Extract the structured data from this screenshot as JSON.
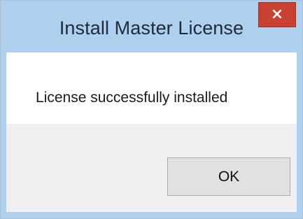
{
  "window": {
    "title": "Install Master License",
    "close_icon": "close-icon",
    "close_glyph": "×"
  },
  "dialog": {
    "message": "License successfully installed",
    "ok_label": "OK"
  },
  "colors": {
    "titlebar": "#afcfee",
    "close_button": "#c84131",
    "footer": "#f0f0f0",
    "button_face": "#e1e1e1"
  }
}
